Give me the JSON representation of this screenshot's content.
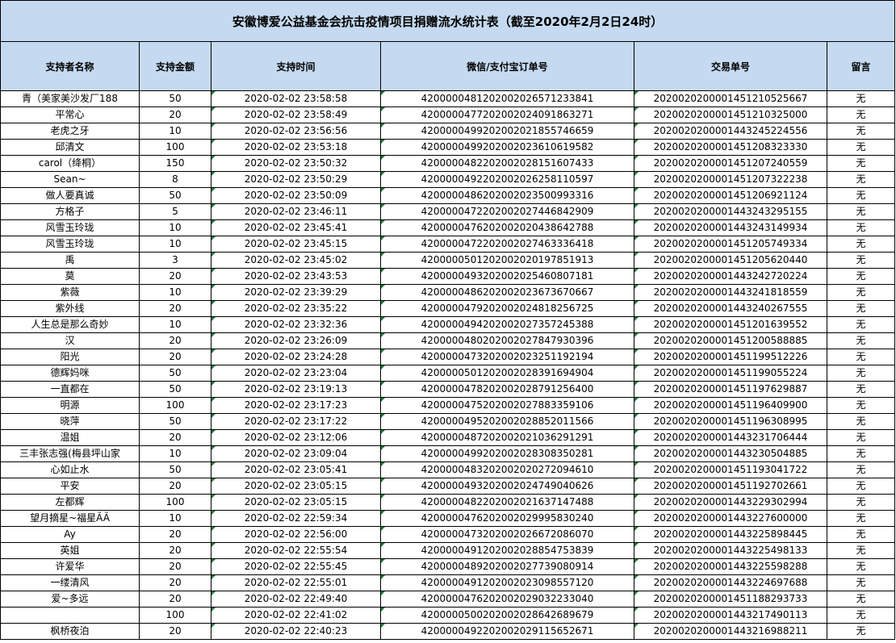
{
  "title": "安徽博爱公益基金会抗击疫情项目捐赠流水统计表（截至2020年2月2日24时）",
  "columns": [
    "支持者名称",
    "支持金额",
    "支持时间",
    "微信/支付宝订单号",
    "交易单号",
    "留言"
  ],
  "rows": [
    [
      "青（美家美沙发厂188",
      "50",
      "2020-02-02 23:58:58",
      "4200000481202002026571233841",
      "2020020200001451210525667",
      "无"
    ],
    [
      "平常心",
      "20",
      "2020-02-02 23:58:49",
      "4200000477202002024091863271",
      "2020020200001451210325000",
      "无"
    ],
    [
      "老虎之牙",
      "10",
      "2020-02-02 23:56:56",
      "4200000499202002021855746659",
      "2020020200001443245224556",
      "无"
    ],
    [
      "邱清文",
      "100",
      "2020-02-02 23:53:18",
      "4200000499202002023610619582",
      "2020020200001451208323330",
      "无"
    ],
    [
      "carol（绛桐）",
      "150",
      "2020-02-02 23:50:32",
      "4200000482202002028151607433",
      "2020020200001451207240559",
      "无"
    ],
    [
      "Sean~",
      "8",
      "2020-02-02 23:50:29",
      "4200000492202002026258110597",
      "2020020200001451207322238",
      "无"
    ],
    [
      "做人要真诚",
      "50",
      "2020-02-02 23:50:09",
      "4200000486202002023500993316",
      "2020020200001451206921124",
      "无"
    ],
    [
      "方格子",
      "5",
      "2020-02-02 23:46:11",
      "4200000472202002027446842909",
      "2020020200001443243295155",
      "无"
    ],
    [
      "风雪玉玲珑",
      "10",
      "2020-02-02 23:45:41",
      "4200000476202002020438642788",
      "2020020200001443243149934",
      "无"
    ],
    [
      "风雪玉玲珑",
      "10",
      "2020-02-02 23:45:15",
      "4200000472202002027463336418",
      "2020020200001451205749334",
      "无"
    ],
    [
      "禹",
      "3",
      "2020-02-02 23:45:02",
      "4200000501202002020197851913",
      "2020020200001451205620440",
      "无"
    ],
    [
      "莫",
      "20",
      "2020-02-02 23:43:53",
      "4200000493202002025460807181",
      "2020020200001443242720224",
      "无"
    ],
    [
      "紫薇",
      "10",
      "2020-02-02 23:39:29",
      "4200000486202002023673670667",
      "2020020200001443241818559",
      "无"
    ],
    [
      "紫外线",
      "20",
      "2020-02-02 23:35:22",
      "4200000479202002024818256725",
      "2020020200001443240267555",
      "无"
    ],
    [
      "人生总是那么奇妙",
      "10",
      "2020-02-02 23:32:36",
      "4200000494202002027357245388",
      "2020020200001451201639552",
      "无"
    ],
    [
      "汉",
      "20",
      "2020-02-02 23:26:09",
      "4200000480202002027847930396",
      "2020020200001451200588885",
      "无"
    ],
    [
      "阳光",
      "20",
      "2020-02-02 23:24:28",
      "4200000473202002023251192194",
      "2020020200001451199512226",
      "无"
    ],
    [
      "德辉妈咪",
      "50",
      "2020-02-02 23:23:04",
      "4200000501202002028391694904",
      "2020020200001451199055224",
      "无"
    ],
    [
      "一直都在",
      "50",
      "2020-02-02 23:19:13",
      "4200000478202002028791256400",
      "2020020200001451197629887",
      "无"
    ],
    [
      "明源",
      "100",
      "2020-02-02 23:17:23",
      "4200000475202002027883359106",
      "2020020200001451196409900",
      "无"
    ],
    [
      "晓萍",
      "50",
      "2020-02-02 23:17:22",
      "4200000495202002028852011566",
      "2020020200001451196308995",
      "无"
    ],
    [
      "温姐",
      "20",
      "2020-02-02 23:12:06",
      "4200000487202002021036291291",
      "2020020200001443231706444",
      "无"
    ],
    [
      "三丰张志强(梅县坪山家",
      "10",
      "2020-02-02 23:09:04",
      "4200000499202002028308350281",
      "2020020200001443230504885",
      "无"
    ],
    [
      "心如止水",
      "50",
      "2020-02-02 23:05:41",
      "4200000483202002020272094610",
      "2020020200001451193041722",
      "无"
    ],
    [
      "平安",
      "20",
      "2020-02-02 23:05:15",
      "4200000493202002024749040626",
      "2020020200001451192702661",
      "无"
    ],
    [
      "左都辉",
      "100",
      "2020-02-02 23:05:15",
      "4200000482202002021637147488",
      "2020020200001443229302994",
      "无"
    ],
    [
      "望月摘星~福星ÃÃ",
      "10",
      "2020-02-02 22:59:34",
      "4200000476202002029995830240",
      "2020020200001443227600000",
      "无"
    ],
    [
      "Ay",
      "20",
      "2020-02-02 22:56:00",
      "4200000473202002026672086070",
      "2020020200001443225898445",
      "无"
    ],
    [
      "英姐",
      "20",
      "2020-02-02 22:55:54",
      "4200000491202002028854753839",
      "2020020200001443225498133",
      "无"
    ],
    [
      "许爱华",
      "20",
      "2020-02-02 22:55:45",
      "4200000489202002027739080914",
      "2020020200001443225598288",
      "无"
    ],
    [
      "一缕清风",
      "20",
      "2020-02-02 22:55:01",
      "4200000491202002023098557120",
      "2020020200001443224697688",
      "无"
    ],
    [
      "爱~多远",
      "20",
      "2020-02-02 22:49:40",
      "4200000476202002029032233040",
      "2020020200001451188293733",
      "无"
    ],
    [
      "",
      "100",
      "2020-02-02 22:41:02",
      "4200000500202002028642689679",
      "2020020200001443217490113",
      "无"
    ],
    [
      "枫桥夜泊",
      "20",
      "2020-02-02 22:40:23",
      "4200000492202002029115652671",
      "2020020200001443216988211",
      "无"
    ]
  ]
}
